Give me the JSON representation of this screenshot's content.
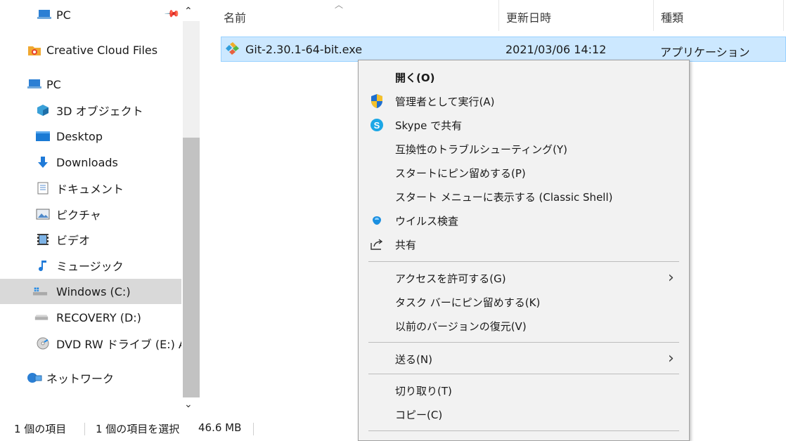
{
  "nav": {
    "pinned_pc": "PC",
    "items": [
      {
        "label": "Creative Cloud Files",
        "icon": "creative-cloud-icon"
      },
      {
        "label": "PC",
        "icon": "pc-icon"
      },
      {
        "label": "3D オブジェクト",
        "icon": "3d-objects-icon"
      },
      {
        "label": "Desktop",
        "icon": "desktop-icon"
      },
      {
        "label": "Downloads",
        "icon": "downloads-icon"
      },
      {
        "label": "ドキュメント",
        "icon": "documents-icon"
      },
      {
        "label": "ピクチャ",
        "icon": "pictures-icon"
      },
      {
        "label": "ビデオ",
        "icon": "videos-icon"
      },
      {
        "label": "ミュージック",
        "icon": "music-icon"
      },
      {
        "label": "Windows (C:)",
        "icon": "windows-drive-icon",
        "selected": true
      },
      {
        "label": "RECOVERY (D:)",
        "icon": "drive-icon"
      },
      {
        "label": "DVD RW ドライブ (E:) Au",
        "icon": "dvd-drive-icon"
      },
      {
        "label": "ネットワーク",
        "icon": "network-icon"
      }
    ]
  },
  "columns": {
    "name": "名前",
    "date": "更新日時",
    "type": "種類"
  },
  "file": {
    "name": "Git-2.30.1-64-bit.exe",
    "date": "2021/03/06 14:12",
    "type": "アプリケーション"
  },
  "status": {
    "count": "1 個の項目",
    "selected": "1 個の項目を選択",
    "size": "46.6 MB"
  },
  "context_menu": {
    "open": "開く(O)",
    "run_as_admin": "管理者として実行(A)",
    "skype_share": "Skype で共有",
    "compat": "互換性のトラブルシューティング(Y)",
    "pin_start": "スタートにピン留めする(P)",
    "start_menu_classic": "スタート メニューに表示する (Classic Shell)",
    "virus_scan": "ウイルス検査",
    "share": "共有",
    "give_access": "アクセスを許可する(G)",
    "pin_taskbar": "タスク バーにピン留めする(K)",
    "restore_versions": "以前のバージョンの復元(V)",
    "send_to": "送る(N)",
    "cut": "切り取り(T)",
    "copy": "コピー(C)"
  },
  "colors": {
    "selection_bg": "#cce8ff",
    "nav_selected_bg": "#d9d9d9",
    "menu_bg": "#f2f2f2"
  }
}
